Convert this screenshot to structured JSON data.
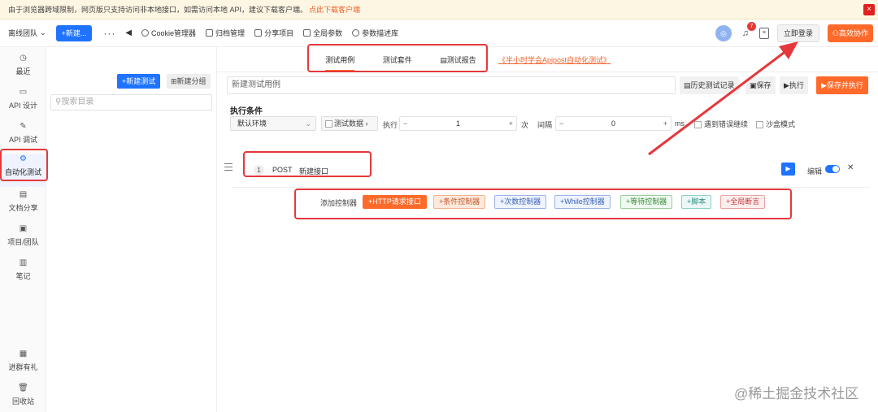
{
  "banner": {
    "message": "由于浏览器跨域限制，网页版只支持访问非本地接口，如需访问本地 API，建议下载客户端。",
    "link": "点此下载客户端",
    "close": "×"
  },
  "topbar": {
    "team": "离线团队",
    "new_button": "+新建...",
    "more": "···",
    "back": "◀",
    "tools": [
      {
        "icon": "cookie-icon",
        "label": "Cookie管理器"
      },
      {
        "icon": "archive-icon",
        "label": "归档管理"
      },
      {
        "icon": "share-icon",
        "label": "分享项目"
      },
      {
        "icon": "globe-params-icon",
        "label": "全局参数"
      },
      {
        "icon": "param-lib-icon",
        "label": "参数描述库"
      }
    ],
    "notification_count": "7",
    "login": "立即登录",
    "collab": "高效协作"
  },
  "leftnav": [
    {
      "icon": "clock-icon",
      "label": "最近"
    },
    {
      "icon": "api-design-icon",
      "label": "API 设计"
    },
    {
      "icon": "api-debug-icon",
      "label": "API 调试"
    },
    {
      "icon": "automation-icon",
      "label": "自动化测试"
    },
    {
      "icon": "doc-share-icon",
      "label": "文档分享"
    },
    {
      "icon": "project-icon",
      "label": "项目/团队"
    },
    {
      "icon": "note-icon",
      "label": "笔记"
    },
    {
      "icon": "gift-icon",
      "label": "进群有礼"
    },
    {
      "icon": "trash-icon",
      "label": "回收站"
    }
  ],
  "dirpanel": {
    "new_test": "新建测试",
    "new_group": "新建分组",
    "search_placeholder": "搜索目录"
  },
  "tabs": {
    "items": [
      "测试用例",
      "测试套件",
      "测试报告"
    ],
    "link": "《半小时学会Apipost自动化测试》"
  },
  "case": {
    "name_placeholder": "新建测试用例",
    "history": "历史测试记录",
    "save": "保存",
    "execute": "执行",
    "save_execute": "保存并执行"
  },
  "conditions": {
    "title": "执行条件",
    "env": "默认环境",
    "test_data": "测试数据",
    "exec_label": "执行",
    "exec_count": "1",
    "times_unit": "次",
    "interval_label": "间隔",
    "interval_value": "0",
    "ms_unit": "ms",
    "continue_on_error": "遇到错误继续",
    "sandbox": "沙盒模式"
  },
  "step": {
    "index": "1",
    "method": "POST",
    "name": "新建接口",
    "edit": "编辑"
  },
  "controllers": {
    "label": "添加控制器",
    "items": [
      "+HTTP请求接口",
      "+条件控制器",
      "+次数控制器",
      "+While控制器",
      "+等待控制器",
      "+脚本",
      "+全局断言"
    ]
  },
  "watermark": "@稀土掘金技术社区",
  "colors": {
    "primary": "#1f73ff",
    "accent": "#ff6a2a",
    "annotation": "#e5383b"
  }
}
